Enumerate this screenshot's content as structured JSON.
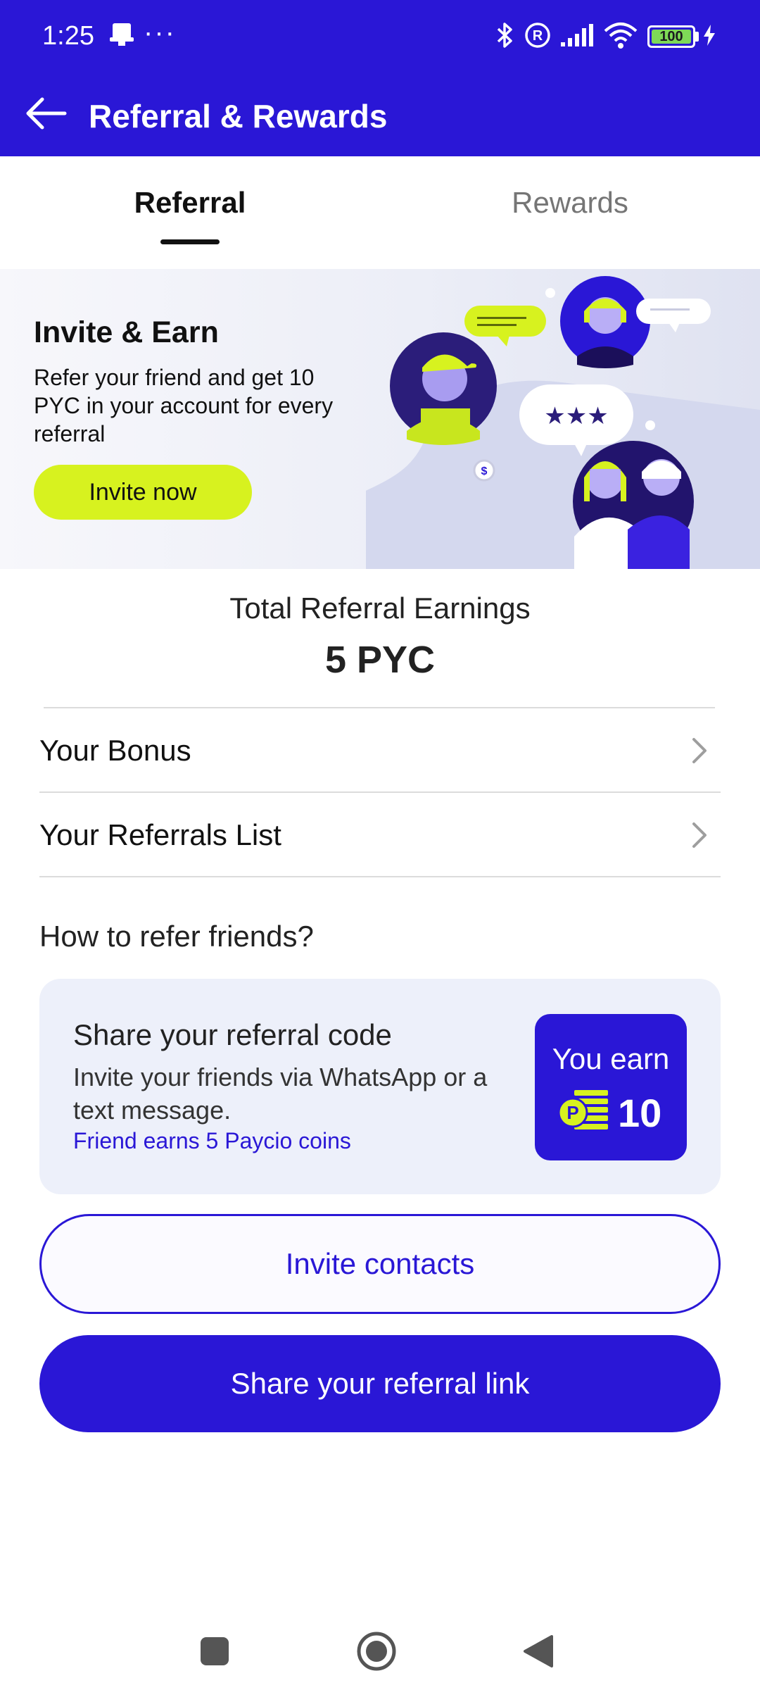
{
  "status_bar": {
    "time": "1:25",
    "overflow_dots": "···",
    "battery_level": "100",
    "icons": [
      "notification-icon",
      "bluetooth-icon",
      "registered-icon",
      "signal-icon",
      "wifi-icon",
      "battery-icon",
      "charging-icon"
    ]
  },
  "app_bar": {
    "title": "Referral & Rewards",
    "back_icon": "arrow-left-icon"
  },
  "tabs": [
    {
      "label": "Referral",
      "active": true
    },
    {
      "label": "Rewards",
      "active": false
    }
  ],
  "banner": {
    "title": "Invite & Earn",
    "text": "Refer your friend and get 10 PYC in your account for every referral",
    "button_label": "Invite now"
  },
  "earnings": {
    "label": "Total Referral Earnings",
    "value": "5 PYC"
  },
  "rows": [
    {
      "label": "Your Bonus"
    },
    {
      "label": "Your Referrals List"
    }
  ],
  "how_to": {
    "title": "How to refer friends?",
    "card_title": "Share your referral code",
    "card_text": "Invite your friends via WhatsApp or a text message.",
    "card_sub": "Friend earns 5 Paycio coins",
    "badge_label": "You earn",
    "badge_value": "10"
  },
  "buttons": {
    "invite_contacts": "Invite contacts",
    "share_link": "Share your referral link"
  },
  "colors": {
    "brand": "#2a17d6",
    "accent": "#d7f21f",
    "card_bg": "#edf0fa"
  }
}
